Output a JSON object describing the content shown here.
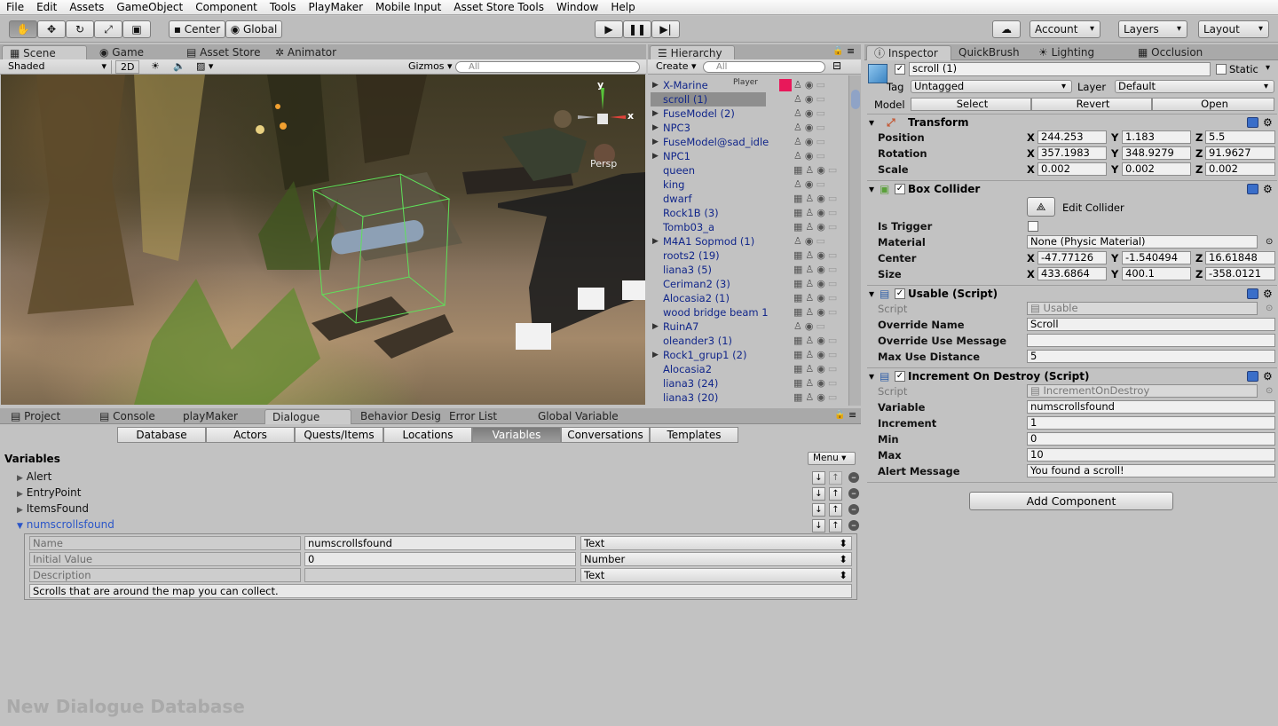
{
  "menubar": [
    "File",
    "Edit",
    "Assets",
    "GameObject",
    "Component",
    "Tools",
    "PlayMaker",
    "Mobile Input",
    "Asset Store Tools",
    "Window",
    "Help"
  ],
  "toolbar": {
    "center_label": "Center",
    "global_label": "Global",
    "account_label": "Account",
    "layers_label": "Layers",
    "layout_label": "Layout"
  },
  "scene_tabs": [
    "Scene",
    "Game",
    "Asset Store",
    "Animator"
  ],
  "scene_bar": {
    "shading": "Shaded",
    "mode2d": "2D",
    "gizmos": "Gizmos",
    "search_placeholder": "All"
  },
  "scene_labels": {
    "persp": "Persp",
    "x_axis": "x",
    "y_axis": "y"
  },
  "hierarchy": {
    "tab": "Hierarchy",
    "create_label": "Create",
    "search_placeholder": "All",
    "player_tag": "Player",
    "items": [
      {
        "name": "X-Marine",
        "arrow": true
      },
      {
        "name": "scroll (1)",
        "selected": true
      },
      {
        "name": "FuseModel (2)",
        "arrow": true
      },
      {
        "name": "NPC3",
        "arrow": true
      },
      {
        "name": "FuseModel@sad_idle",
        "arrow": true
      },
      {
        "name": "NPC1",
        "arrow": true
      },
      {
        "name": "queen"
      },
      {
        "name": "king"
      },
      {
        "name": "dwarf"
      },
      {
        "name": "Rock1B (3)"
      },
      {
        "name": "Tomb03_a"
      },
      {
        "name": "M4A1 Sopmod (1)",
        "arrow": true
      },
      {
        "name": "roots2 (19)"
      },
      {
        "name": "liana3 (5)"
      },
      {
        "name": "Ceriman2 (3)"
      },
      {
        "name": "Alocasia2 (1)"
      },
      {
        "name": "wood bridge beam 1"
      },
      {
        "name": "RuinA7",
        "arrow": true
      },
      {
        "name": "oleander3 (1)"
      },
      {
        "name": "Rock1_grup1 (2)",
        "arrow": true
      },
      {
        "name": "Alocasia2"
      },
      {
        "name": "liana3 (24)"
      },
      {
        "name": "liana3 (20)"
      }
    ]
  },
  "inspector": {
    "tabs": [
      "Inspector",
      "QuickBrush",
      "Lighting",
      "Occlusion"
    ],
    "object_name": "scroll (1)",
    "static_label": "Static",
    "tag_label": "Tag",
    "tag_value": "Untagged",
    "layer_label": "Layer",
    "layer_value": "Default",
    "model_label": "Model",
    "model_buttons": [
      "Select",
      "Revert",
      "Open"
    ],
    "transform": {
      "title": "Transform",
      "rows": [
        {
          "label": "Position",
          "x": "244.253",
          "y": "1.183",
          "z": "5.5"
        },
        {
          "label": "Rotation",
          "x": "357.1983",
          "y": "348.9279",
          "z": "91.9627"
        },
        {
          "label": "Scale",
          "x": "0.002",
          "y": "0.002",
          "z": "0.002"
        }
      ]
    },
    "box_collider": {
      "title": "Box Collider",
      "edit_label": "Edit Collider",
      "is_trigger_label": "Is Trigger",
      "material_label": "Material",
      "material_value": "None (Physic Material)",
      "rows": [
        {
          "label": "Center",
          "x": "-47.77126",
          "y": "-1.540494",
          "z": "16.61848"
        },
        {
          "label": "Size",
          "x": "433.6864",
          "y": "400.1",
          "z": "-358.0121"
        }
      ]
    },
    "usable": {
      "title": "Usable (Script)",
      "script_label": "Script",
      "script_value": "Usable",
      "override_name_label": "Override Name",
      "override_name_value": "Scroll",
      "override_use_label": "Override Use Message",
      "override_use_value": "",
      "max_dist_label": "Max Use Distance",
      "max_dist_value": "5"
    },
    "increment": {
      "title": "Increment On Destroy (Script)",
      "script_label": "Script",
      "script_value": "IncrementOnDestroy",
      "variable_label": "Variable",
      "variable_value": "numscrollsfound",
      "increment_label": "Increment",
      "increment_value": "1",
      "min_label": "Min",
      "min_value": "0",
      "max_label": "Max",
      "max_value": "10",
      "alert_label": "Alert Message",
      "alert_value": "You found a scroll!"
    },
    "add_component": "Add Component"
  },
  "bottom_tabs": [
    "Project",
    "Console",
    "playMaker",
    "Dialogue",
    "Behavior Desig",
    "Error List",
    "Global Variable"
  ],
  "dialogue": {
    "tabs": [
      "Database",
      "Actors",
      "Quests/Items",
      "Locations",
      "Variables",
      "Conversations",
      "Templates"
    ],
    "heading": "Variables",
    "menu_label": "Menu",
    "variables": [
      "Alert",
      "EntryPoint",
      "ItemsFound",
      "numscrollsfound"
    ],
    "detail": {
      "name_label": "Name",
      "name_value": "numscrollsfound",
      "name_type": "Text",
      "init_label": "Initial Value",
      "init_value": "0",
      "init_type": "Number",
      "desc_label": "Description",
      "desc_value": "",
      "desc_type": "Text",
      "description_text": "Scrolls that are around the map you can collect."
    },
    "watermark": "New Dialogue Database"
  },
  "colors": {
    "selection": "#3d6fcf",
    "hierarchy_text": "#11268a",
    "player_tag": "#e8185a"
  }
}
